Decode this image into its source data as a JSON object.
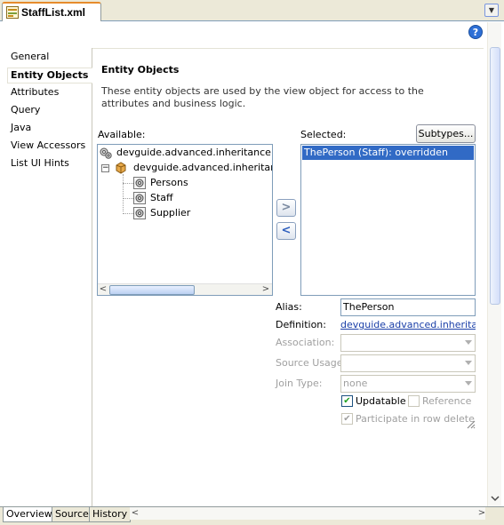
{
  "tab": {
    "title": "StaffList.xml",
    "menu_arrow": "▼"
  },
  "help": {
    "label": "?"
  },
  "nav": {
    "items": [
      {
        "label": "General"
      },
      {
        "label": "Entity Objects"
      },
      {
        "label": "Attributes"
      },
      {
        "label": "Query"
      },
      {
        "label": "Java"
      },
      {
        "label": "View Accessors"
      },
      {
        "label": "List UI Hints"
      }
    ],
    "selected": "Entity Objects"
  },
  "main": {
    "heading": "Entity Objects",
    "description": "These entity objects are used by the view object for access to the attributes and business logic."
  },
  "available": {
    "label": "Available:",
    "tree": [
      {
        "label": "devguide.advanced.inheritance.Inhe",
        "level": 0,
        "icon": "entities-icon"
      },
      {
        "label": "devguide.advanced.inheritance",
        "level": 1,
        "icon": "package-icon",
        "expand": "−"
      },
      {
        "label": "Persons",
        "level": 2,
        "icon": "entity-icon"
      },
      {
        "label": "Staff",
        "level": 2,
        "icon": "entity-icon"
      },
      {
        "label": "Supplier",
        "level": 2,
        "icon": "entity-icon"
      }
    ],
    "scroll_left": "<",
    "scroll_right": ">"
  },
  "shuttle": {
    "add": ">",
    "remove": "<"
  },
  "selected": {
    "label": "Selected:",
    "subtypes_button": "Subtypes...",
    "items": [
      "ThePerson (Staff): overridden"
    ]
  },
  "form": {
    "alias_label": "Alias:",
    "alias_value": "ThePerson",
    "definition_label": "Definition:",
    "definition_value": "devguide.advanced.inherita…",
    "association_label": "Association:",
    "source_usage_label": "Source Usage:",
    "join_type_label": "Join Type:",
    "join_type_value": "none",
    "updatable_label": "Updatable",
    "updatable_checked": true,
    "reference_label": "Reference",
    "reference_checked": false,
    "participate_label": "Participate in row delete",
    "participate_checked": true,
    "check_mark": "✔"
  },
  "bottom_tabs": [
    {
      "label": "Overview",
      "active": true
    },
    {
      "label": "Source",
      "active": false
    },
    {
      "label": "History",
      "active": false
    }
  ],
  "bottom_scroll": {
    "left": "<",
    "right": ">"
  }
}
